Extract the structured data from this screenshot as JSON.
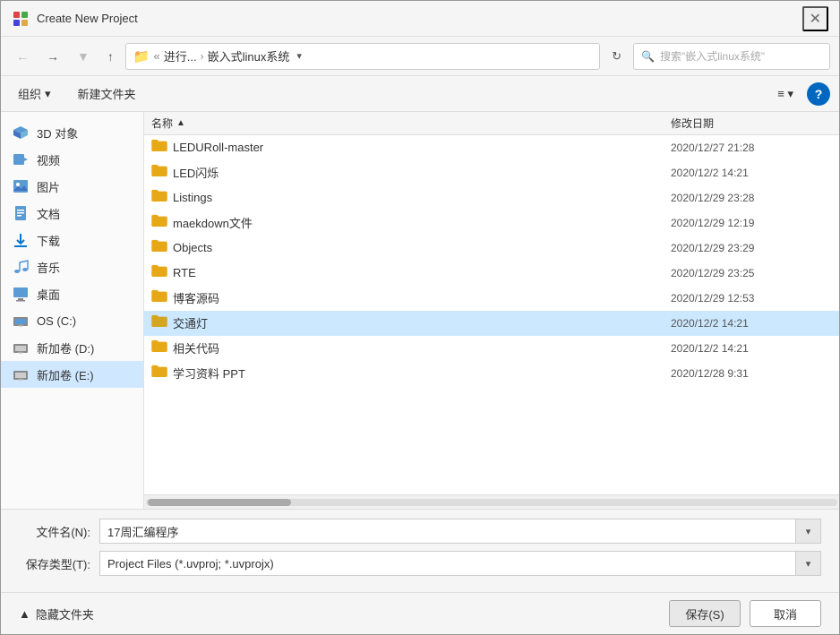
{
  "titleBar": {
    "title": "Create New Project",
    "closeLabel": "✕"
  },
  "navToolbar": {
    "backLabel": "‹",
    "forwardLabel": "›",
    "upLabel": "↑",
    "pathFolder": "📁",
    "pathParts": [
      "进行...",
      "嵌入式linux系统"
    ],
    "pathSeparator": "›",
    "dropdownLabel": "▾",
    "refreshLabel": "↻",
    "searchPlaceholder": "搜索\"嵌入式linux系统\""
  },
  "actionToolbar": {
    "organizeLabel": "组织",
    "newFolderLabel": "新建文件夹",
    "viewLabel": "≡",
    "viewDropdownLabel": "▾",
    "helpLabel": "?"
  },
  "sidebar": {
    "items": [
      {
        "id": "3d",
        "icon": "🔷",
        "label": "3D 对象"
      },
      {
        "id": "video",
        "icon": "🎬",
        "label": "视频"
      },
      {
        "id": "picture",
        "icon": "🖼",
        "label": "图片"
      },
      {
        "id": "document",
        "icon": "📄",
        "label": "文档"
      },
      {
        "id": "download",
        "icon": "⬇",
        "label": "下载"
      },
      {
        "id": "music",
        "icon": "♪",
        "label": "音乐"
      },
      {
        "id": "desktop",
        "icon": "🖥",
        "label": "桌面"
      },
      {
        "id": "os",
        "icon": "💾",
        "label": "OS (C:)"
      },
      {
        "id": "drived",
        "icon": "💾",
        "label": "新加卷 (D:)"
      },
      {
        "id": "drivee",
        "icon": "💾",
        "label": "新加卷 (E:)"
      }
    ]
  },
  "fileList": {
    "columnName": "名称",
    "columnDate": "修改日期",
    "sortIcon": "▲",
    "files": [
      {
        "name": "LEDURoll-master",
        "date": "2020/12/27 21:28",
        "selected": false
      },
      {
        "name": "LED闪烁",
        "date": "2020/12/2 14:21",
        "selected": false
      },
      {
        "name": "Listings",
        "date": "2020/12/29 23:28",
        "selected": false
      },
      {
        "name": "maekdown文件",
        "date": "2020/12/29 12:19",
        "selected": false
      },
      {
        "name": "Objects",
        "date": "2020/12/29 23:29",
        "selected": false
      },
      {
        "name": "RTE",
        "date": "2020/12/29 23:25",
        "selected": false
      },
      {
        "name": "博客源码",
        "date": "2020/12/29 12:53",
        "selected": false
      },
      {
        "name": "交通灯",
        "date": "2020/12/2 14:21",
        "selected": true
      },
      {
        "name": "相关代码",
        "date": "2020/12/2 14:21",
        "selected": false
      },
      {
        "name": "学习资料  PPT",
        "date": "2020/12/28 9:31",
        "selected": false
      }
    ]
  },
  "form": {
    "fileNameLabel": "文件名(N):",
    "fileNameValue": "17周汇编程序",
    "fileTypeLabel": "保存类型(T):",
    "fileTypeValue": "Project Files (*.uvproj; *.uvprojx)"
  },
  "footer": {
    "hideFolderLabel": "隐藏文件夹",
    "hideIcon": "▲",
    "saveLabel": "保存(S)",
    "cancelLabel": "取消"
  }
}
